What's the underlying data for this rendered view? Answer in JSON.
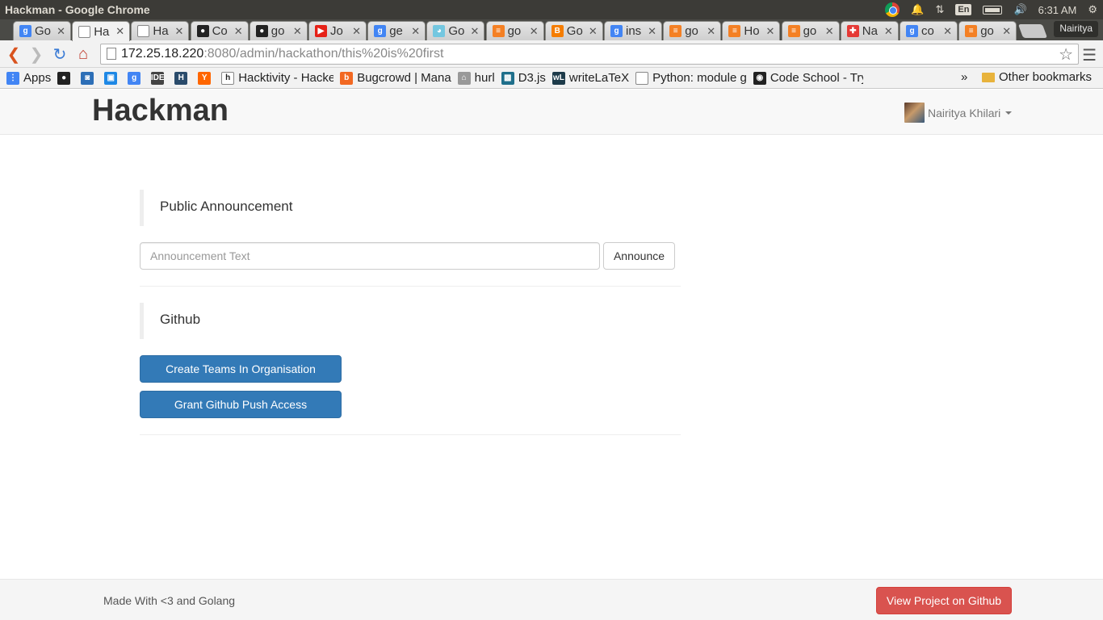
{
  "window": {
    "title": "Hackman - Google Chrome"
  },
  "tray": {
    "lang": "En",
    "time": "6:31 AM"
  },
  "tabs": [
    {
      "label": "Go",
      "icon": "google-icon",
      "color": "#4285f4",
      "glyph": "g"
    },
    {
      "label": "Ha",
      "icon": "page-icon",
      "color": "#ffffff",
      "glyph": ""
    },
    {
      "label": "Ha",
      "icon": "page-icon",
      "color": "#ffffff",
      "glyph": ""
    },
    {
      "label": "Co",
      "icon": "github-icon",
      "color": "#222222",
      "glyph": "●"
    },
    {
      "label": "go",
      "icon": "github-icon",
      "color": "#222222",
      "glyph": "●"
    },
    {
      "label": "Jo",
      "icon": "youtube-icon",
      "color": "#e62117",
      "glyph": "▶"
    },
    {
      "label": "ge",
      "icon": "google-icon",
      "color": "#4285f4",
      "glyph": "g"
    },
    {
      "label": "Go",
      "icon": "gopher-icon",
      "color": "#74c7e0",
      "glyph": "◕"
    },
    {
      "label": "go",
      "icon": "stackoverflow-icon",
      "color": "#f48024",
      "glyph": "≡"
    },
    {
      "label": "Go",
      "icon": "blogger-icon",
      "color": "#f57d00",
      "glyph": "B"
    },
    {
      "label": "ins",
      "icon": "google-icon",
      "color": "#4285f4",
      "glyph": "g"
    },
    {
      "label": "go",
      "icon": "stackoverflow-icon",
      "color": "#f48024",
      "glyph": "≡"
    },
    {
      "label": "Ho",
      "icon": "stackoverflow-icon",
      "color": "#f48024",
      "glyph": "≡"
    },
    {
      "label": "go",
      "icon": "stackoverflow-icon",
      "color": "#f48024",
      "glyph": "≡"
    },
    {
      "label": "Na",
      "icon": "puzzle-icon",
      "color": "#e53935",
      "glyph": "✚"
    },
    {
      "label": "co",
      "icon": "google-icon",
      "color": "#4285f4",
      "glyph": "g"
    },
    {
      "label": "go",
      "icon": "stackoverflow-icon",
      "color": "#f48024",
      "glyph": "≡"
    }
  ],
  "profile": "Nairitya",
  "address": {
    "host": "172.25.18.220",
    "rest": ":8080/admin/hackathon/this%20is%20first"
  },
  "bookmarks": [
    {
      "label": "Apps",
      "icon": "apps-icon",
      "color": "#4285f4",
      "glyph": "⋮"
    },
    {
      "label": "",
      "icon": "github-icon",
      "color": "#222222",
      "glyph": "●"
    },
    {
      "label": "",
      "icon": "shield-icon",
      "color": "#2d6fb7",
      "glyph": "◙"
    },
    {
      "label": "",
      "icon": "tool-icon",
      "color": "#1e88e5",
      "glyph": "▣"
    },
    {
      "label": "",
      "icon": "google-icon",
      "color": "#4285f4",
      "glyph": "g"
    },
    {
      "label": "",
      "icon": "ide-icon",
      "color": "#444444",
      "glyph": "IDE"
    },
    {
      "label": "",
      "icon": "h-icon",
      "color": "#2a4b6b",
      "glyph": "H"
    },
    {
      "label": "",
      "icon": "ycombinator-icon",
      "color": "#ff6600",
      "glyph": "Y"
    },
    {
      "label": "Hacktivity - Hacke",
      "icon": "hackerone-icon",
      "color": "#ffffff",
      "glyph": "h"
    },
    {
      "label": "Bugcrowd | Mana",
      "icon": "bugcrowd-icon",
      "color": "#f26822",
      "glyph": "b"
    },
    {
      "label": "hurl",
      "icon": "hurl-icon",
      "color": "#999999",
      "glyph": "⌂"
    },
    {
      "label": "D3.js",
      "icon": "d3-icon",
      "color": "#1f6f8b",
      "glyph": "▩"
    },
    {
      "label": "writeLaTeX",
      "icon": "writelatex-icon",
      "color": "#1d3b4a",
      "glyph": "wL"
    },
    {
      "label": "Python: module g",
      "icon": "page-icon",
      "color": "#ffffff",
      "glyph": ""
    },
    {
      "label": "Code School - Try",
      "icon": "codeschool-icon",
      "color": "#222222",
      "glyph": "◉"
    }
  ],
  "bookmarks_more": "»",
  "other_bookmarks": "Other bookmarks",
  "app": {
    "brand": "Hackman",
    "user": "Nairitya Khilari"
  },
  "announcement": {
    "heading": "Public Announcement",
    "placeholder": "Announcement Text",
    "value": "",
    "button": "Announce"
  },
  "github": {
    "heading": "Github",
    "create_teams": "Create Teams In Organisation",
    "grant_access": "Grant Github Push Access"
  },
  "footer": {
    "text": "Made With <3 and Golang",
    "button": "View Project on Github"
  }
}
